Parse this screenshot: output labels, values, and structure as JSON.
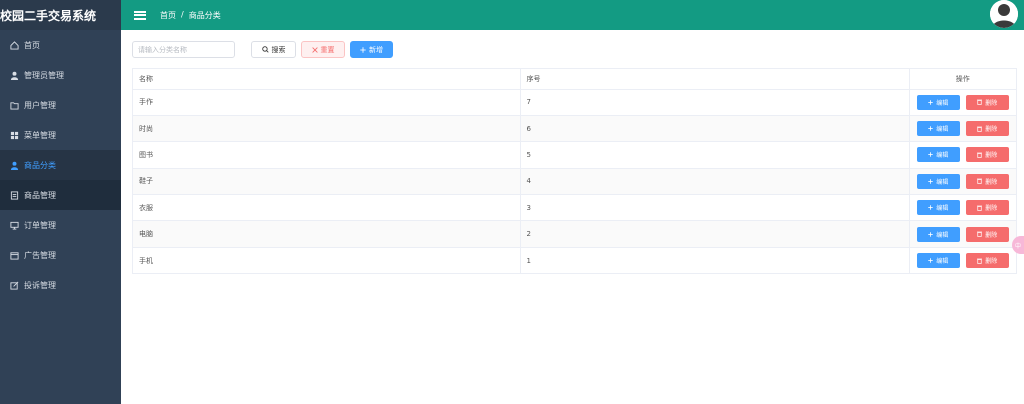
{
  "app": {
    "title": "校园二手交易系统"
  },
  "sidebar": {
    "items": [
      {
        "label": "首页",
        "icon": "home-icon"
      },
      {
        "label": "管理员管理",
        "icon": "user-icon"
      },
      {
        "label": "用户管理",
        "icon": "folder-icon"
      },
      {
        "label": "菜单管理",
        "icon": "grid-icon"
      },
      {
        "label": "商品分类",
        "icon": "user-icon",
        "active": true
      },
      {
        "label": "商品管理",
        "icon": "document-icon",
        "sub": true
      },
      {
        "label": "订单管理",
        "icon": "monitor-icon"
      },
      {
        "label": "广告管理",
        "icon": "calendar-icon"
      },
      {
        "label": "投诉管理",
        "icon": "edit-icon"
      }
    ]
  },
  "header": {
    "breadcrumb": [
      "首页",
      "/",
      "商品分类"
    ]
  },
  "toolbar": {
    "search_placeholder": "请输入分类名称",
    "search_label": "搜索",
    "reset_label": "重置",
    "add_label": "新增"
  },
  "table": {
    "headers": {
      "name": "名称",
      "order": "序号",
      "ops": "操作"
    },
    "rows": [
      {
        "name": "手作",
        "order": "7"
      },
      {
        "name": "时尚",
        "order": "6"
      },
      {
        "name": "图书",
        "order": "5"
      },
      {
        "name": "鞋子",
        "order": "4"
      },
      {
        "name": "衣服",
        "order": "3"
      },
      {
        "name": "电脑",
        "order": "2"
      },
      {
        "name": "手机",
        "order": "1"
      }
    ],
    "edit_label": "编辑",
    "delete_label": "删除"
  },
  "float_tag": {
    "label": "中"
  },
  "colors": {
    "sidebar_bg": "#304156",
    "header_bg": "#139b83",
    "primary": "#409eff",
    "danger": "#f56c6c"
  }
}
